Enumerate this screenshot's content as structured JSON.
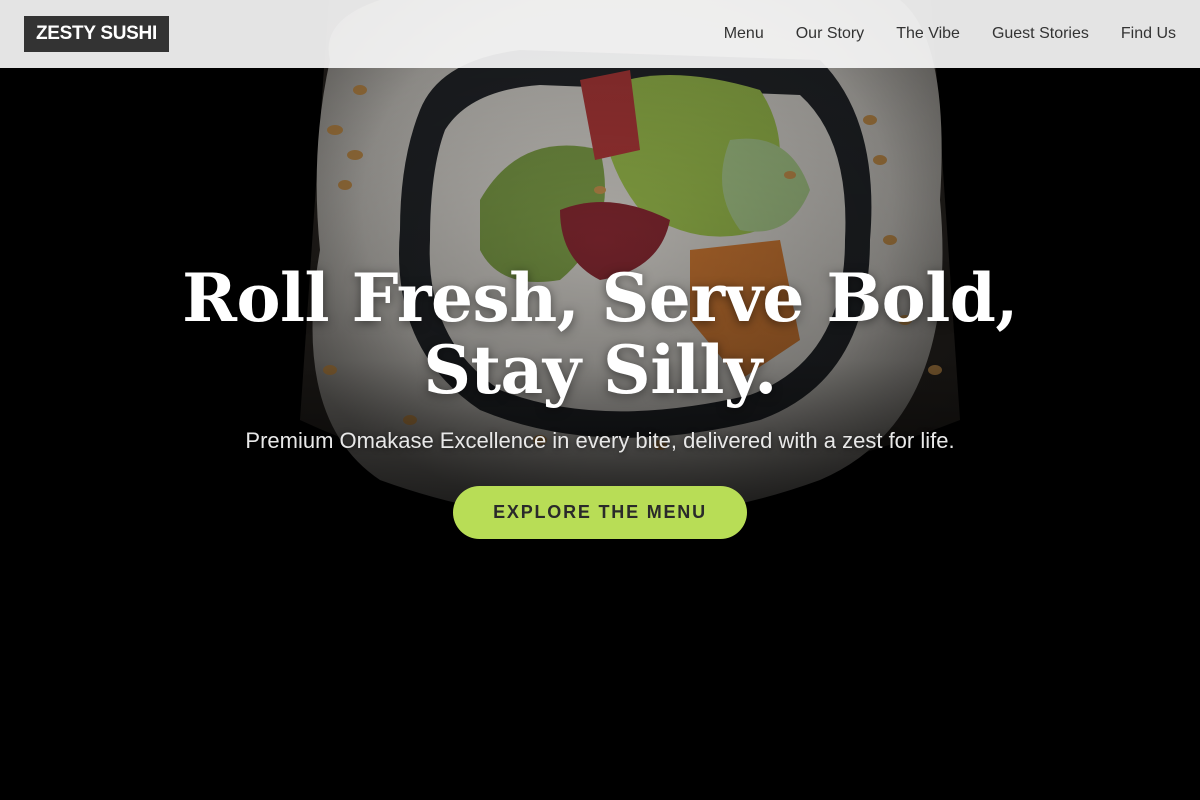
{
  "brand": {
    "logo_text": "ZESTY SUSHI"
  },
  "nav": {
    "items": [
      {
        "label": "Menu"
      },
      {
        "label": "Our Story"
      },
      {
        "label": "The Vibe"
      },
      {
        "label": "Guest Stories"
      },
      {
        "label": "Find Us"
      }
    ]
  },
  "hero": {
    "title_line1": "Roll Fresh, Serve Bold,",
    "title_line2": "Stay Silly.",
    "subtitle": "Premium Omakase Excellence in every bite, delivered with a zest for life.",
    "cta_label": "EXPLORE THE MENU",
    "image": "sushi-roll-photo"
  },
  "colors": {
    "accent": "#b8dd56",
    "header_bg": "#f5f5f5",
    "logo_bg": "#333333",
    "hero_bg": "#000000"
  }
}
